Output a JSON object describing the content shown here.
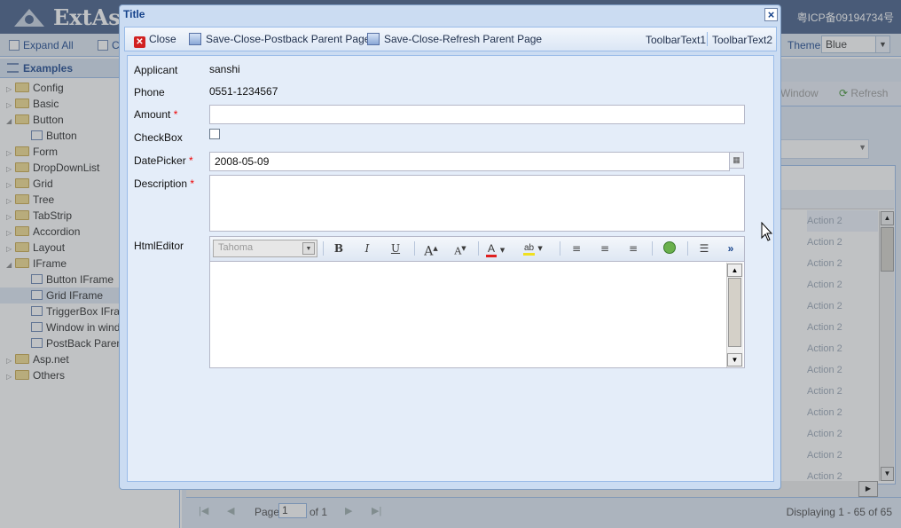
{
  "background": {
    "app_title": "ExtAsp",
    "icp": "粤ICP备09194734号",
    "toolbar": {
      "expand_all": "Expand All",
      "second_button": "C",
      "theme_label": "Theme:",
      "theme_value": "Blue"
    },
    "left_panel": {
      "title": "Examples",
      "items": [
        {
          "label": "Config",
          "type": "folder",
          "expanded": false,
          "level": 0
        },
        {
          "label": "Basic",
          "type": "folder",
          "expanded": false,
          "level": 0
        },
        {
          "label": "Button",
          "type": "folder",
          "expanded": true,
          "level": 0
        },
        {
          "label": "Button",
          "type": "page",
          "level": 1
        },
        {
          "label": "Form",
          "type": "folder",
          "expanded": false,
          "level": 0
        },
        {
          "label": "DropDownList",
          "type": "folder",
          "expanded": false,
          "level": 0
        },
        {
          "label": "Grid",
          "type": "folder",
          "expanded": false,
          "level": 0
        },
        {
          "label": "Tree",
          "type": "folder",
          "expanded": false,
          "level": 0
        },
        {
          "label": "TabStrip",
          "type": "folder",
          "expanded": false,
          "level": 0
        },
        {
          "label": "Accordion",
          "type": "folder",
          "expanded": false,
          "level": 0
        },
        {
          "label": "Layout",
          "type": "folder",
          "expanded": false,
          "level": 0
        },
        {
          "label": "IFrame",
          "type": "folder",
          "expanded": true,
          "level": 0
        },
        {
          "label": "Button IFrame",
          "type": "page",
          "level": 1
        },
        {
          "label": "Grid IFrame",
          "type": "page",
          "level": 1,
          "selected": true
        },
        {
          "label": "TriggerBox IFram",
          "type": "page",
          "level": 1
        },
        {
          "label": "Window in windo",
          "type": "page",
          "level": 1
        },
        {
          "label": "PostBack Parent",
          "type": "page",
          "level": 1
        },
        {
          "label": "Asp.net",
          "type": "folder",
          "expanded": false,
          "level": 0
        },
        {
          "label": "Others",
          "type": "folder",
          "expanded": false,
          "level": 0
        }
      ]
    },
    "right_toolbar": {
      "window_button": "Window",
      "refresh_button": "Refresh"
    },
    "grid": {
      "action_cells": [
        "Action 2",
        "Action 2",
        "Action 2",
        "Action 2",
        "Action 2",
        "Action 2",
        "Action 2",
        "Action 2",
        "Action 2",
        "Action 2",
        "Action 2",
        "Action 2",
        "Action 2"
      ]
    },
    "pager": {
      "page_label": "Page",
      "page_value": "1",
      "of_label": "of 1",
      "displaying": "Displaying 1 - 65 of 65"
    }
  },
  "window": {
    "title": "Title",
    "close_icon": "close-icon",
    "toolbar": {
      "close": "Close",
      "save_close_postback": "Save-Close-Postback Parent Page",
      "save_close_refresh": "Save-Close-Refresh Parent Page",
      "text1": "ToolbarText1",
      "text2": "ToolbarText2"
    },
    "form": {
      "applicant_label": "Applicant",
      "applicant_value": "sanshi",
      "phone_label": "Phone",
      "phone_value": "0551-1234567",
      "amount_label": "Amount",
      "amount_value": "",
      "required_mark": "*",
      "checkbox_label": "CheckBox",
      "checkbox_checked": false,
      "datepicker_label": "DatePicker",
      "datepicker_value": "2008-05-09",
      "description_label": "Description",
      "description_value": "",
      "htmleditor_label": "HtmlEditor",
      "editor_font": "Tahoma"
    },
    "editor_toolbar": {
      "bold": "B",
      "italic": "I",
      "underline": "U",
      "grow_font": "A",
      "shrink_font": "A",
      "font_color": "A",
      "highlight": "ab",
      "more": "»"
    }
  }
}
